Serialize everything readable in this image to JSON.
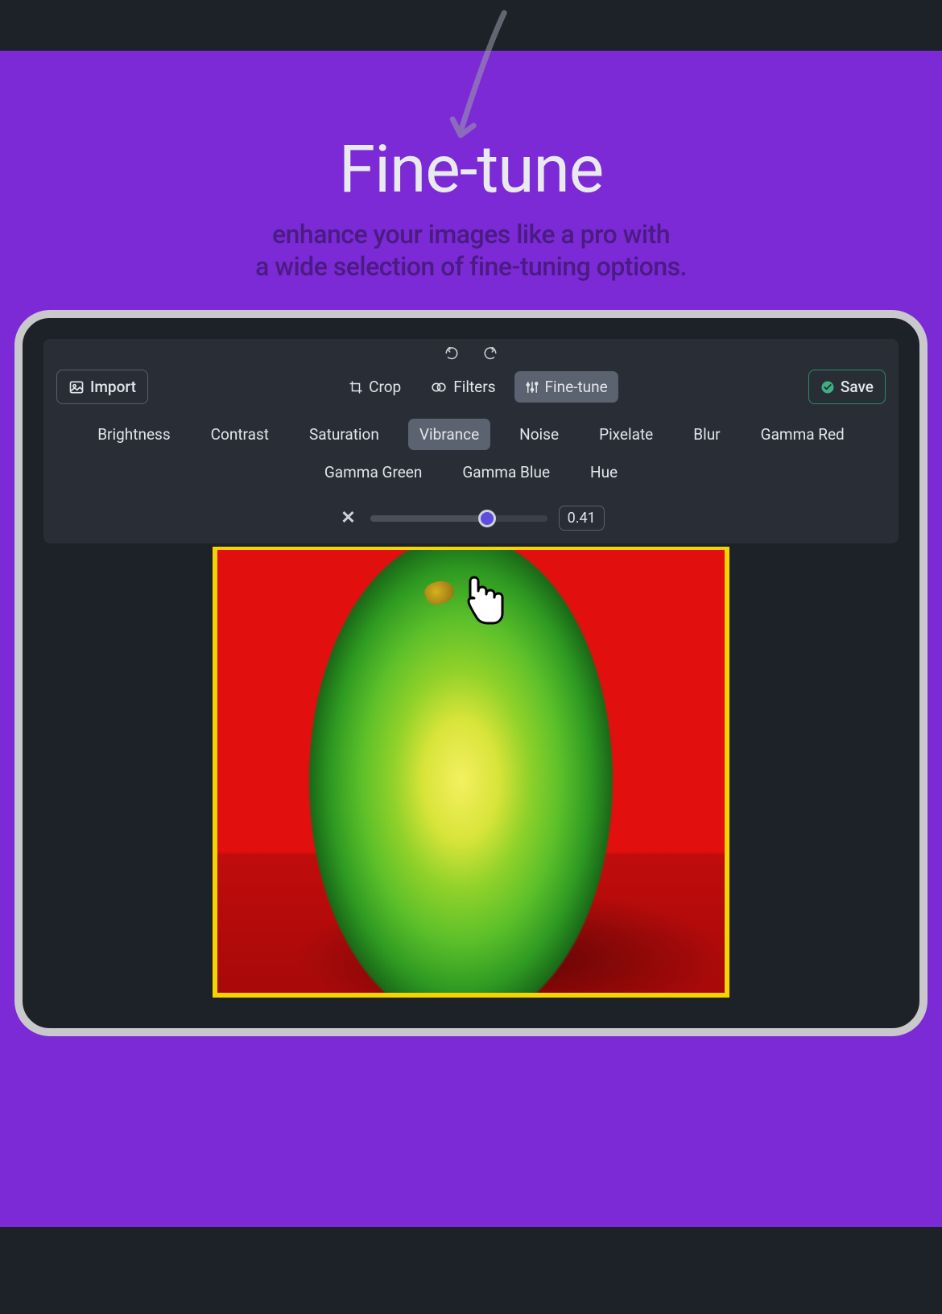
{
  "hero": {
    "title": "Fine-tune",
    "subtitle_line1": "enhance your images like a pro with",
    "subtitle_line2": "a wide selection of fine-tuning options."
  },
  "editor": {
    "import_label": "Import",
    "save_label": "Save",
    "modes": {
      "crop": "Crop",
      "filters": "Filters",
      "finetune": "Fine-tune",
      "active": "finetune"
    },
    "adjustments": [
      "Brightness",
      "Contrast",
      "Saturation",
      "Vibrance",
      "Noise",
      "Pixelate",
      "Blur",
      "Gamma Red",
      "Gamma Green",
      "Gamma Blue",
      "Hue"
    ],
    "active_adjustment": "Vibrance",
    "slider": {
      "value": "0.41",
      "percent": 66
    }
  },
  "colors": {
    "accent_purple": "#7c29d6",
    "panel_bg": "#282d36",
    "frame_border": "#c9c9cc",
    "save_border": "#2e8b6a",
    "slider_thumb": "#5d4de0"
  }
}
